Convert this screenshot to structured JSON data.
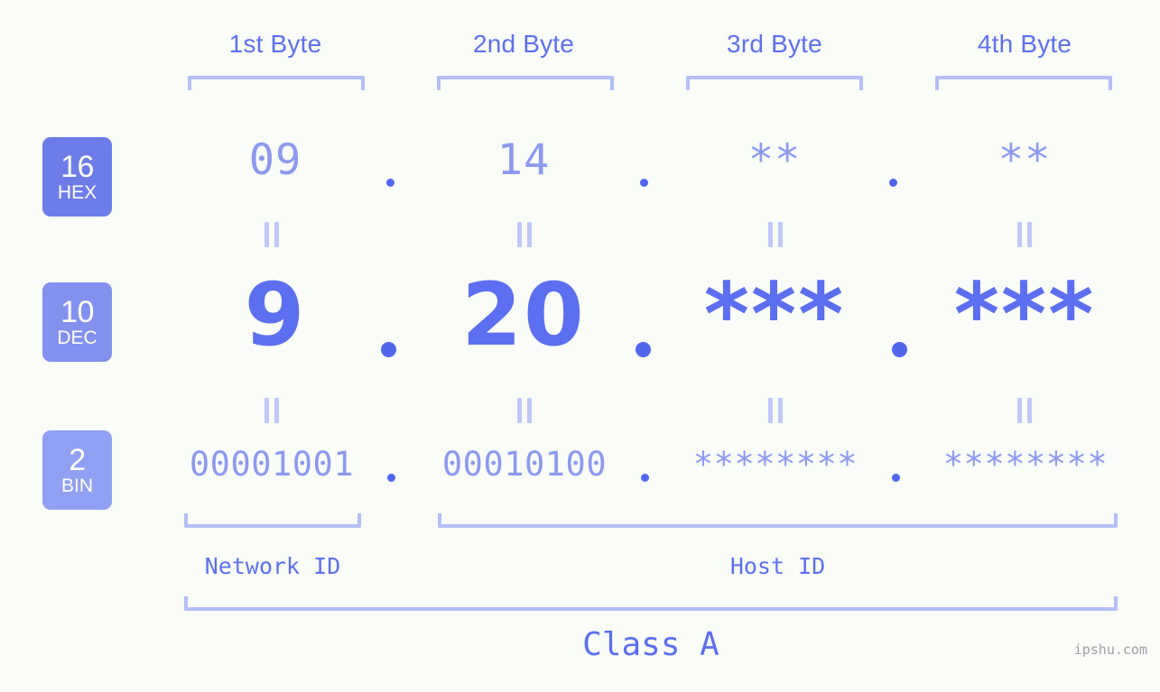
{
  "watermark": "ipshu.com",
  "headers": [
    {
      "label": "1st Byte"
    },
    {
      "label": "2nd Byte"
    },
    {
      "label": "3rd Byte"
    },
    {
      "label": "4th Byte"
    }
  ],
  "bases": [
    {
      "num": "16",
      "label": "HEX",
      "color": "#6c7de9"
    },
    {
      "num": "10",
      "label": "DEC",
      "color": "#8291ee"
    },
    {
      "num": "2",
      "label": "BIN",
      "color": "#90a1f3"
    }
  ],
  "rows": {
    "hex": {
      "base": "16",
      "name": "HEX",
      "values": [
        "09",
        "14",
        "**",
        "**"
      ]
    },
    "dec": {
      "base": "10",
      "name": "DEC",
      "values": [
        "9",
        "20",
        "***",
        "***"
      ]
    },
    "bin": {
      "base": "2",
      "name": "BIN",
      "values": [
        "00001001",
        "00010100",
        "********",
        "********"
      ]
    }
  },
  "separator": ".",
  "equals_marker": "=",
  "sections": {
    "network_id": "Network ID",
    "host_id": "Host ID",
    "class": "Class A"
  },
  "colors": {
    "background": "#fafcf8",
    "accent_strong": "#5b6ff0",
    "accent_light": "#8c99f1",
    "bracket": "#b4bef8",
    "dot": "#4f66ed",
    "watermark": "#9aa0a8"
  }
}
